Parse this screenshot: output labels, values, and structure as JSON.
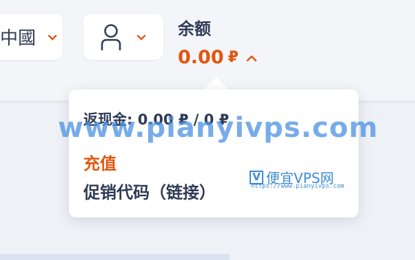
{
  "header": {
    "language": {
      "label": "中國",
      "icon": "chevron-down-icon"
    },
    "user": {
      "icon": "user-icon",
      "chevron_icon": "chevron-down-icon"
    },
    "balance": {
      "label": "余额",
      "amount": "0.00",
      "currency": "₽",
      "toggle_icon": "chevron-up-icon"
    }
  },
  "dropdown": {
    "cashback": "返现金: 0.00 ₽ / 0 ₽",
    "topup_label": "充值",
    "promo_label": "促销代码（链接）"
  },
  "watermark": {
    "text": "www.pianyivps.com",
    "logo_letter": "V",
    "logo_text": "便宜VPS网",
    "url": "https://www.pianyivps.com"
  },
  "colors": {
    "accent": "#e2560f",
    "text": "#2f3b55",
    "watermark": "#4a90e2"
  }
}
